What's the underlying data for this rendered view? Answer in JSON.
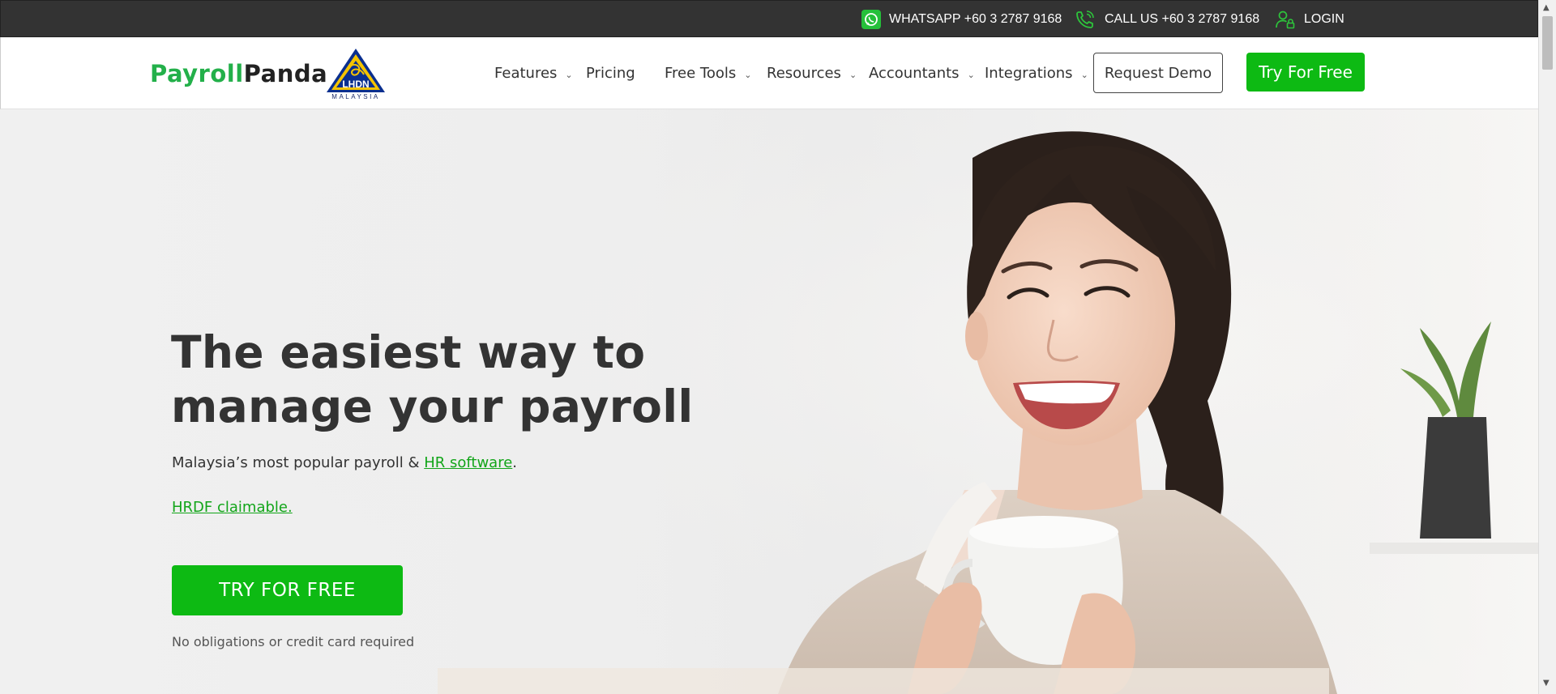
{
  "topbar": {
    "whatsapp_label": "WHATSAPP +60 3 2787 9168",
    "call_label": "CALL US +60 3 2787 9168",
    "login_label": "LOGIN",
    "icons": [
      "whatsapp-icon",
      "phone-icon",
      "user-lock-icon"
    ]
  },
  "header": {
    "logo_part1": "Payroll",
    "logo_part2": "Panda",
    "badge_text": "LHDN",
    "badge_subtext": "MALAYSIA",
    "nav": [
      {
        "label": "Features",
        "has_dropdown": true
      },
      {
        "label": "Pricing",
        "has_dropdown": false
      },
      {
        "label": "Free Tools",
        "has_dropdown": true
      },
      {
        "label": "Resources",
        "has_dropdown": true
      },
      {
        "label": "Accountants",
        "has_dropdown": true
      },
      {
        "label": "Integrations",
        "has_dropdown": true
      }
    ],
    "chevron": "⌄",
    "request_demo_label": "Request Demo",
    "try_free_label": "Try For Free"
  },
  "hero": {
    "title": "The easiest way to manage your payroll",
    "subtitle_prefix": "Malaysia’s most popular payroll & ",
    "subtitle_link": "HR software",
    "subtitle_suffix": ".",
    "hrdf_link": "HRDF claimable.",
    "cta_label": "TRY FOR FREE",
    "cta_note": "No obligations or credit card required"
  },
  "colors": {
    "brand_green": "#0dba13",
    "link_green": "#12a519",
    "topbar_bg": "#333333",
    "text_dark": "#333333"
  }
}
